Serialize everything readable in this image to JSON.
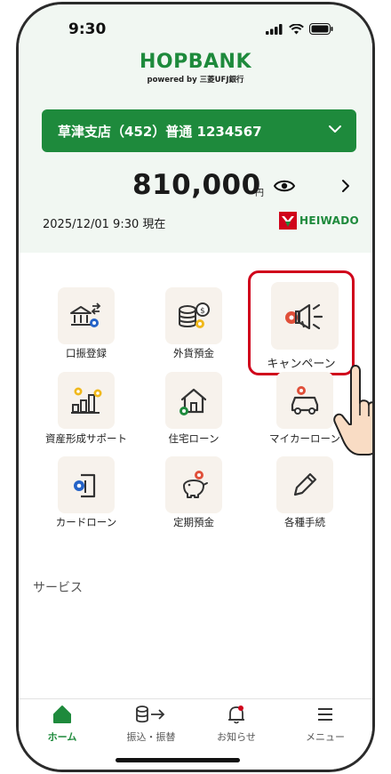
{
  "status": {
    "time": "9:30"
  },
  "brand": {
    "name": "HOPBANK",
    "sub": "powered by  三菱UFJ銀行"
  },
  "account": {
    "label": "草津支店（452）普通 1234567"
  },
  "balance": {
    "amount": "810,000",
    "unit": "円",
    "datetime": "2025/12/01 9:30 現在"
  },
  "partner": {
    "name": "HEIWADO"
  },
  "menu": [
    {
      "label": "口振登録"
    },
    {
      "label": "外貨預金"
    },
    {
      "label": "キャンペーン"
    },
    {
      "label": "資産形成サポート"
    },
    {
      "label": "住宅ローン"
    },
    {
      "label": "マイカーローン"
    },
    {
      "label": "カードローン"
    },
    {
      "label": "定期預金"
    },
    {
      "label": "各種手続"
    }
  ],
  "services": {
    "title": "サービス"
  },
  "tabs": [
    {
      "label": "ホーム"
    },
    {
      "label": "振込・振替"
    },
    {
      "label": "お知らせ"
    },
    {
      "label": "メニュー"
    }
  ],
  "colors": {
    "brand_green": "#1e8a3c",
    "accent_orange": "#e0503a",
    "accent_yellow": "#f0b81b",
    "accent_blue": "#2563c7",
    "highlight_red": "#d0021b"
  }
}
